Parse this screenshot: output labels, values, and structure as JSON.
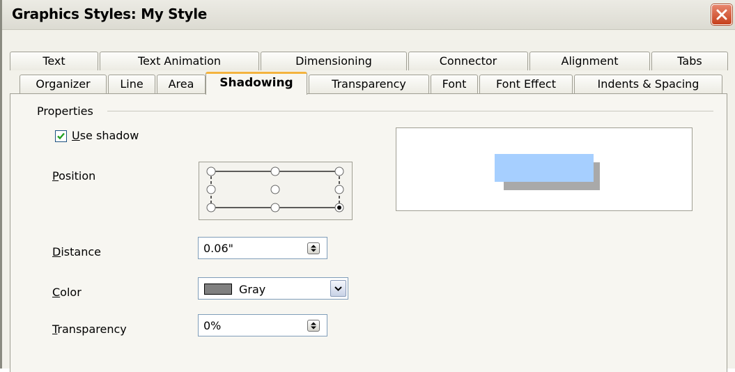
{
  "window": {
    "title": "Graphics Styles: My Style"
  },
  "tabs_row1": [
    "Text",
    "Text Animation",
    "Dimensioning",
    "Connector",
    "Alignment",
    "Tabs"
  ],
  "tabs_row2": [
    "Organizer",
    "Line",
    "Area",
    "Shadowing",
    "Transparency",
    "Font",
    "Font Effect",
    "Indents & Spacing"
  ],
  "active_tab": "Shadowing",
  "properties": {
    "section_label": "Properties",
    "use_shadow": {
      "label_mnemonic": "U",
      "label_rest": "se shadow",
      "checked": true
    },
    "position": {
      "label_mnemonic": "P",
      "label_rest": "osition",
      "selected": "bottom-right"
    },
    "distance": {
      "label_mnemonic": "D",
      "label_rest": "istance",
      "value": "0.06\""
    },
    "color": {
      "label_mnemonic": "C",
      "label_rest": "olor",
      "value": "Gray",
      "swatch": "#808080"
    },
    "transparency": {
      "label_mnemonic": "T",
      "label_rest": "ransparency",
      "value": "0%"
    }
  },
  "preview": {
    "object_color": "#a6cfff",
    "shadow_color": "#a9a9a9"
  },
  "colors": {
    "active_tab_accent": "#f4b33e",
    "close_button": "#c6401c"
  }
}
